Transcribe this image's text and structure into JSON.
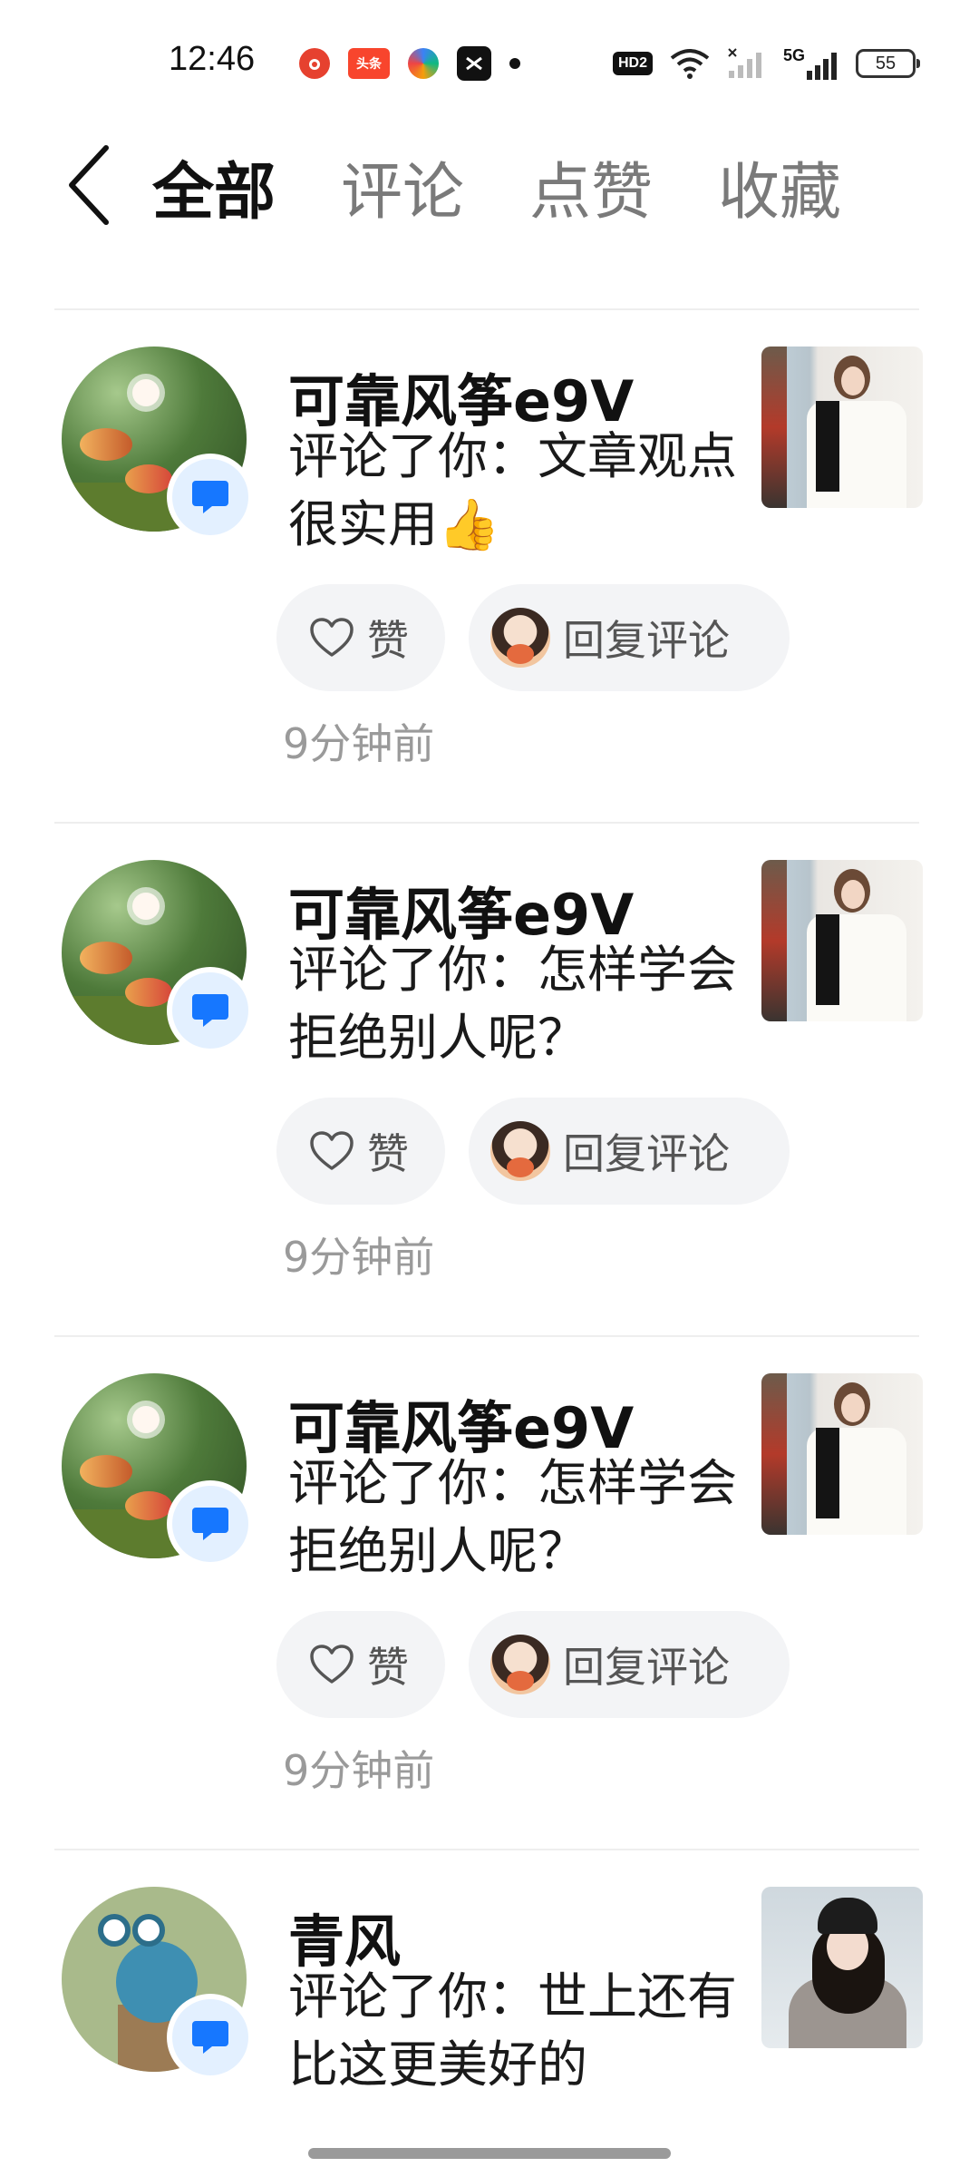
{
  "status_bar": {
    "time": "12:46",
    "app_icons": [
      "weibo-icon",
      "toutiao-icon",
      "colorful-app-icon",
      "capcut-icon",
      "dot-icon"
    ],
    "toutiao_label": "头条",
    "hd_label": "HD2",
    "network_label": "5G",
    "battery": "55"
  },
  "header": {
    "tabs": [
      {
        "label": "全部",
        "active": true
      },
      {
        "label": "评论",
        "active": false
      },
      {
        "label": "点赞",
        "active": false
      },
      {
        "label": "收藏",
        "active": false
      }
    ]
  },
  "notifications": [
    {
      "name": "可靠风筝e9V",
      "comment": "评论了你：文章观点很实用👍",
      "like_label": "赞",
      "reply_label": "回复评论",
      "time": "9分钟前"
    },
    {
      "name": "可靠风筝e9V",
      "comment": "评论了你：怎样学会拒绝别人呢？",
      "like_label": "赞",
      "reply_label": "回复评论",
      "time": "9分钟前"
    },
    {
      "name": "可靠风筝e9V",
      "comment": "评论了你：怎样学会拒绝别人呢？",
      "like_label": "赞",
      "reply_label": "回复评论",
      "time": "9分钟前"
    },
    {
      "name": "青风",
      "comment": "评论了你：世上还有比这更美好的",
      "like_label": "",
      "reply_label": "",
      "time": ""
    }
  ],
  "colors": {
    "accent_blue": "#1677ff",
    "badge_bg": "#e3f0ff",
    "pill_bg": "#f3f4f6",
    "muted_text": "#9a9a9a"
  }
}
